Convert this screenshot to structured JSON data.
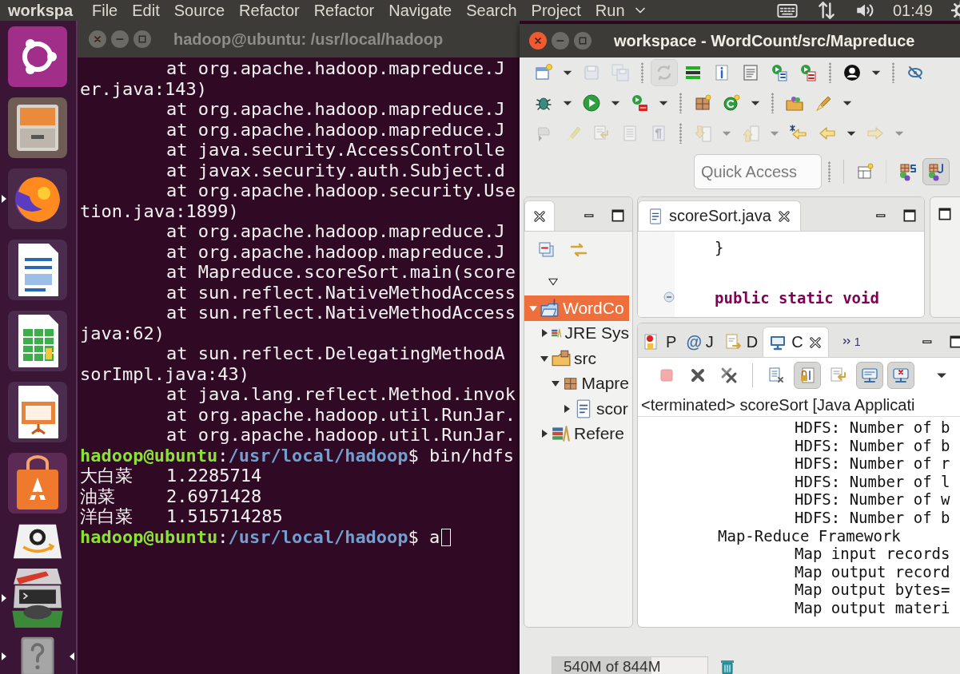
{
  "top_bar": {
    "app_name": "workspa",
    "menus": [
      "File",
      "Edit",
      "Source",
      "Refactor",
      "Refactor",
      "Navigate",
      "Search",
      "Project",
      "Run"
    ],
    "clock": "01:49"
  },
  "launcher": [
    {
      "kind": "dash",
      "running": false,
      "active": false
    },
    {
      "kind": "files",
      "running": false,
      "active": false
    },
    {
      "kind": "browser",
      "running": true,
      "active": false
    },
    {
      "kind": "writer",
      "running": false,
      "active": false
    },
    {
      "kind": "calc",
      "running": false,
      "active": false
    },
    {
      "kind": "impress",
      "running": false,
      "active": false
    },
    {
      "kind": "software",
      "running": false,
      "active": false
    },
    {
      "kind": "amazon",
      "running": false,
      "active": false
    },
    {
      "kind": "stack",
      "running": true,
      "active": false
    },
    {
      "kind": "help",
      "running": true,
      "active": true
    }
  ],
  "terminal": {
    "title": "hadoop@ubuntu: /usr/local/hadoop",
    "lines": [
      {
        "kind": "frame",
        "text": "at org.apache.hadoop.mapreduce.J"
      },
      {
        "kind": "wrap",
        "text": "er.java:143)"
      },
      {
        "kind": "frame",
        "text": "at org.apache.hadoop.mapreduce.J"
      },
      {
        "kind": "frame",
        "text": "at org.apache.hadoop.mapreduce.J"
      },
      {
        "kind": "frame",
        "text": "at java.security.AccessControlle"
      },
      {
        "kind": "frame",
        "text": "at javax.security.auth.Subject.d"
      },
      {
        "kind": "frame",
        "text": "at org.apache.hadoop.security.Use"
      },
      {
        "kind": "wrap",
        "text": "tion.java:1899)"
      },
      {
        "kind": "frame",
        "text": "at org.apache.hadoop.mapreduce.J"
      },
      {
        "kind": "frame",
        "text": "at org.apache.hadoop.mapreduce.J"
      },
      {
        "kind": "frame",
        "text": "at Mapreduce.scoreSort.main(score"
      },
      {
        "kind": "frame",
        "text": "at sun.reflect.NativeMethodAccess"
      },
      {
        "kind": "frame",
        "text": "at sun.reflect.NativeMethodAccess"
      },
      {
        "kind": "wrap",
        "text": "java:62)"
      },
      {
        "kind": "frame",
        "text": "at sun.reflect.DelegatingMethodA"
      },
      {
        "kind": "wrap",
        "text": "sorImpl.java:43)"
      },
      {
        "kind": "frame",
        "text": "at java.lang.reflect.Method.invok"
      },
      {
        "kind": "frame",
        "text": "at org.apache.hadoop.util.RunJar."
      },
      {
        "kind": "frame",
        "text": "at org.apache.hadoop.util.RunJar."
      },
      {
        "kind": "prompt",
        "user": "hadoop@ubuntu",
        "separator": ":",
        "path": "/usr/local/hadoop",
        "command": "$ bin/hdfs",
        "cursor": false
      },
      {
        "kind": "result",
        "key": "大白菜",
        "value": "1.2285714"
      },
      {
        "kind": "result",
        "key": "油菜",
        "value": "2.6971428"
      },
      {
        "kind": "result",
        "key": "洋白菜",
        "value": "1.515714285"
      },
      {
        "kind": "prompt",
        "user": "hadoop@ubuntu",
        "separator": ":",
        "path": "/usr/local/hadoop",
        "command": "$ a",
        "cursor": true
      }
    ]
  },
  "eclipse": {
    "title": "workspace - WordCount/src/Mapreduce",
    "toolbar_rows": [
      [
        {
          "kind": "button",
          "pressed": false,
          "disabled": false,
          "menu": true
        },
        {
          "kind": "button",
          "pressed": false,
          "disabled": true,
          "menu": false
        },
        {
          "kind": "button",
          "pressed": false,
          "disabled": true,
          "menu": false
        },
        {
          "kind": "separator"
        },
        {
          "kind": "button",
          "pressed": true,
          "disabled": true,
          "menu": false
        },
        {
          "kind": "button",
          "pressed": false,
          "disabled": false,
          "menu": false
        },
        {
          "kind": "button",
          "pressed": false,
          "disabled": false,
          "menu": false
        },
        {
          "kind": "button",
          "pressed": false,
          "disabled": false,
          "menu": false
        },
        {
          "kind": "button",
          "pressed": false,
          "disabled": false,
          "menu": false
        },
        {
          "kind": "button",
          "pressed": false,
          "disabled": false,
          "menu": false
        },
        {
          "kind": "separator"
        },
        {
          "kind": "button",
          "pressed": false,
          "disabled": false,
          "menu": true
        },
        {
          "kind": "separator"
        },
        {
          "kind": "button",
          "pressed": false,
          "disabled": false,
          "menu": false
        }
      ],
      [
        {
          "kind": "button",
          "pressed": false,
          "disabled": false,
          "menu": true
        },
        {
          "kind": "button",
          "pressed": false,
          "disabled": false,
          "menu": true
        },
        {
          "kind": "button",
          "pressed": false,
          "disabled": false,
          "menu": true
        },
        {
          "kind": "separator"
        },
        {
          "kind": "button",
          "pressed": false,
          "disabled": false,
          "menu": false
        },
        {
          "kind": "button",
          "pressed": false,
          "disabled": false,
          "menu": true
        },
        {
          "kind": "separator"
        },
        {
          "kind": "button",
          "pressed": false,
          "disabled": false,
          "menu": false
        },
        {
          "kind": "button",
          "pressed": false,
          "disabled": false,
          "menu": true
        }
      ],
      [
        {
          "kind": "button",
          "pressed": false,
          "disabled": true,
          "menu": false
        },
        {
          "kind": "button",
          "pressed": false,
          "disabled": true,
          "menu": false
        },
        {
          "kind": "button",
          "pressed": false,
          "disabled": true,
          "menu": false
        },
        {
          "kind": "button",
          "pressed": false,
          "disabled": true,
          "menu": false
        },
        {
          "kind": "button",
          "pressed": false,
          "disabled": true,
          "menu": false
        },
        {
          "kind": "separator"
        },
        {
          "kind": "button",
          "pressed": false,
          "disabled": true,
          "menu": true
        },
        {
          "kind": "button",
          "pressed": false,
          "disabled": true,
          "menu": true
        },
        {
          "kind": "button",
          "pressed": false,
          "disabled": false,
          "menu": false
        },
        {
          "kind": "button",
          "pressed": false,
          "disabled": false,
          "menu": true
        },
        {
          "kind": "button",
          "pressed": false,
          "disabled": true,
          "menu": true
        }
      ]
    ],
    "quick_access": {
      "placeholder": "Quick Access"
    },
    "perspectives": [
      {
        "selected": false
      },
      {
        "selected": true
      }
    ],
    "package_explorer": {
      "tree": [
        {
          "label": "WordCo",
          "kind": "project",
          "selected": true,
          "expanded": true,
          "children": [
            {
              "label": "JRE Sys",
              "kind": "library",
              "selected": false,
              "expanded": false
            },
            {
              "label": "src",
              "kind": "source",
              "selected": false,
              "expanded": true,
              "children": [
                {
                  "label": "Mapre",
                  "kind": "package",
                  "selected": false,
                  "expanded": true,
                  "children": [
                    {
                      "label": "scor",
                      "kind": "java",
                      "selected": false,
                      "expanded": false
                    }
                  ]
                }
              ]
            },
            {
              "label": "Refere",
              "kind": "library",
              "selected": false,
              "expanded": false
            }
          ]
        }
      ]
    },
    "editor": {
      "tabs": [
        {
          "label": "scoreSort.java",
          "selected": true
        }
      ],
      "lines": [
        {
          "kind": "plain",
          "text": "}",
          "fold": false
        },
        {
          "kind": "keyword",
          "text": "public static void",
          "fold": true
        }
      ]
    },
    "console": {
      "tabs": [
        {
          "kind": "problems",
          "label": "P",
          "selected": false
        },
        {
          "kind": "javadoc",
          "glyph": "@",
          "label": "J",
          "selected": false
        },
        {
          "kind": "declaration",
          "label": "D",
          "selected": false
        },
        {
          "kind": "console",
          "label": "C",
          "selected": true
        }
      ],
      "overflow_count": "1",
      "toolbar": [
        {
          "kind": "button",
          "pressed": false,
          "disabled": true
        },
        {
          "kind": "button",
          "pressed": false,
          "disabled": false
        },
        {
          "kind": "button",
          "pressed": false,
          "disabled": false
        },
        {
          "kind": "separator"
        },
        {
          "kind": "button",
          "pressed": false,
          "disabled": false
        },
        {
          "kind": "button",
          "pressed": true,
          "disabled": false
        },
        {
          "kind": "button",
          "pressed": false,
          "disabled": false
        },
        {
          "kind": "button",
          "pressed": true,
          "disabled": false
        },
        {
          "kind": "button",
          "pressed": true,
          "disabled": false
        }
      ],
      "header": "<terminated> scoreSort [Java Applicati",
      "lines": [
        {
          "kind": "counter",
          "text": "HDFS: Number of b"
        },
        {
          "kind": "counter",
          "text": "HDFS: Number of b"
        },
        {
          "kind": "counter",
          "text": "HDFS: Number of r"
        },
        {
          "kind": "counter",
          "text": "HDFS: Number of l"
        },
        {
          "kind": "counter",
          "text": "HDFS: Number of w"
        },
        {
          "kind": "counter",
          "text": "HDFS: Number of b"
        },
        {
          "kind": "group",
          "text": "Map-Reduce Framework"
        },
        {
          "kind": "counter",
          "text": "Map input records"
        },
        {
          "kind": "counter",
          "text": "Map output record"
        },
        {
          "kind": "counter",
          "text": "Map output bytes="
        },
        {
          "kind": "counter",
          "text": "Map output materi"
        }
      ]
    },
    "status": {
      "heap": "540M of 844M",
      "level": 0.64
    }
  }
}
